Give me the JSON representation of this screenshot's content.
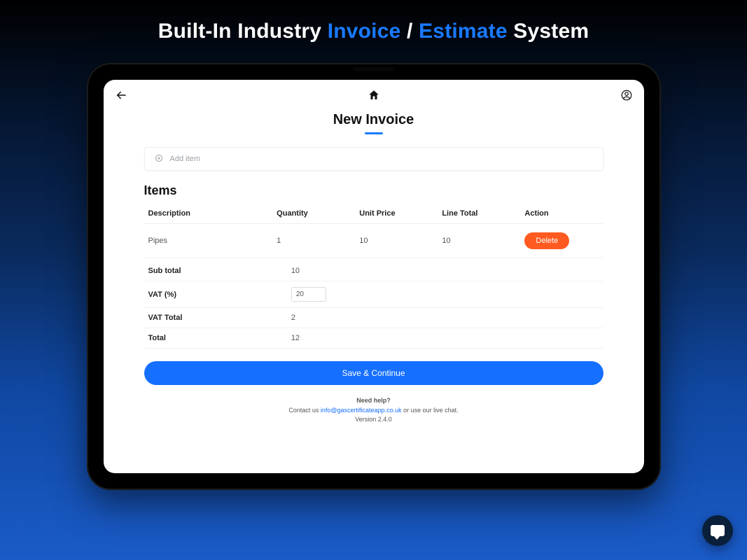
{
  "headline": {
    "part1": "Built-In Industry ",
    "accent1": "Invoice",
    "separator": " / ",
    "accent2": "Estimate",
    "part2": " System"
  },
  "page": {
    "title": "New Invoice",
    "add_item_label": "Add item",
    "items_heading": "Items"
  },
  "table": {
    "headers": {
      "description": "Description",
      "quantity": "Quantity",
      "unit_price": "Unit Price",
      "line_total": "Line Total",
      "action": "Action"
    },
    "rows": [
      {
        "description": "Pipes",
        "quantity": "1",
        "unit_price": "10",
        "line_total": "10",
        "action_label": "Delete"
      }
    ]
  },
  "summary": {
    "subtotal_label": "Sub total",
    "subtotal_value": "10",
    "vat_percent_label": "VAT (%)",
    "vat_percent_value": "20",
    "vat_total_label": "VAT Total",
    "vat_total_value": "2",
    "total_label": "Total",
    "total_value": "12"
  },
  "actions": {
    "save_continue": "Save & Continue"
  },
  "footer": {
    "need_help": "Need help?",
    "contact_prefix": "Contact us ",
    "email": "info@gascertificateapp.co.uk",
    "contact_suffix": " or use our live chat.",
    "version": "Version 2.4.0"
  }
}
